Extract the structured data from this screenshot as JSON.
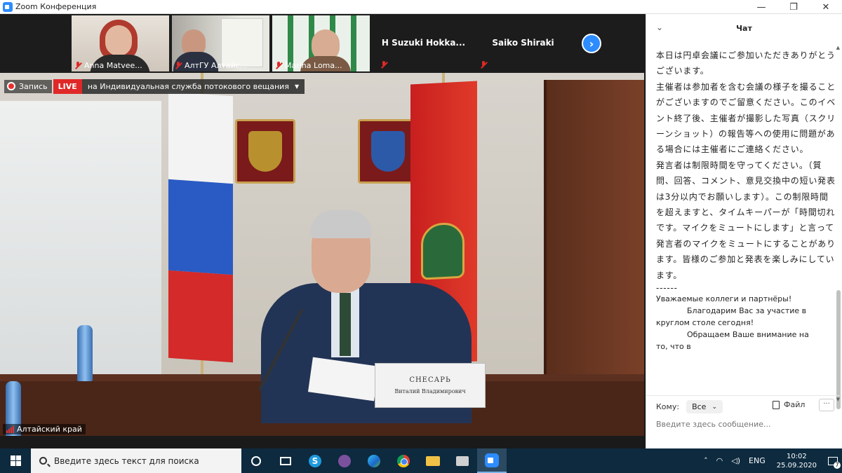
{
  "window": {
    "title": "Zoom Конференция",
    "controls": {
      "minimize": "—",
      "maximize": "❐",
      "close": "✕"
    }
  },
  "thumbnails": [
    {
      "name": "Anna Matvee...",
      "muted": true
    },
    {
      "name": "АлтГУ Алтайс...",
      "muted": true
    },
    {
      "name": "Marina Loma...",
      "muted": true
    },
    {
      "name": "H  Suzuki  Hokka...",
      "muted": true,
      "video": false
    },
    {
      "name": "Saiko Shiraki",
      "muted": true,
      "video": false
    }
  ],
  "next_button": "›",
  "recording": {
    "label": "Запись",
    "live": "LIVE",
    "stream": "на Индивидуальная служба потокового вещания"
  },
  "video": {
    "speaker_label": "Алтайский край",
    "nameplate_line1": "СНЕСАРЬ",
    "nameplate_line2": "Виталий Владимирович"
  },
  "chat": {
    "title": "Чат",
    "messages": [
      "本日は円卓会議にご参加いただきありがとうございます。",
      "主催者は参加者を含む会議の様子を撮ることがございますのでご留意ください。このイベント終了後、主催者が撮影した写真（スクリーンショット）の報告等への使用に問題がある場合には主催者にご連絡ください。",
      "発言者は制限時間を守ってください。（質問、回答、コメント、意見交換中の短い発表は3分以内でお願いします）。この制限時間を超えますと、タイムキーパーが「時間切れです。マイクをミュートにします」と言って発言者のマイクをミュートにすることがあります。皆様のご参加と発表を楽しみにしています。",
      "------"
    ],
    "ru_line1": "Уважаемые коллеги и партнёры!",
    "ru_line2": "Благодарим Вас за участие в",
    "ru_line3": "круглом столе сегодня!",
    "ru_line4": "Обращаем Ваше внимание на",
    "ru_line5": "то, что в",
    "to_label": "Кому:",
    "to_value": "Все",
    "file_label": "Файл",
    "more_label": "···",
    "input_placeholder": "Введите здесь сообщение..."
  },
  "taskbar": {
    "search_placeholder": "Введите здесь текст для поиска",
    "apps": [
      "cortana",
      "task-view",
      "skype",
      "viber",
      "edge",
      "chrome",
      "file-explorer",
      "scanner",
      "zoom"
    ],
    "language": "ENG",
    "time": "10:02",
    "date": "25.09.2020",
    "notifications": "7"
  }
}
